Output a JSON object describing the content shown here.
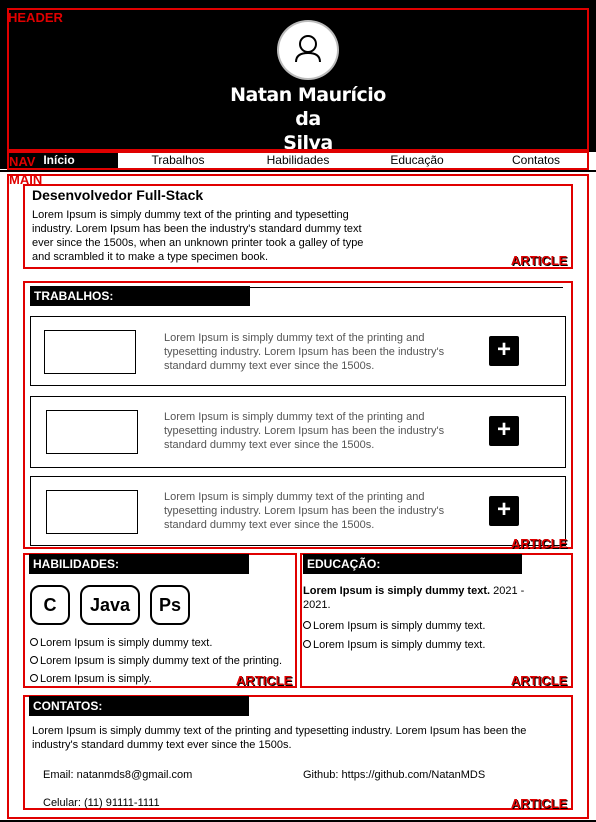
{
  "labels": {
    "header": "HEADER",
    "nav": "NAV",
    "main": "MAIN",
    "article": "ARTICLE"
  },
  "header": {
    "name_line1": "Natan Maurício da",
    "name_line2": "Silva",
    "avatar_icon": "user-icon"
  },
  "nav": {
    "items": [
      "Início",
      "Trabalhos",
      "Habilidades",
      "Educação",
      "Contatos"
    ],
    "active": "Início"
  },
  "intro": {
    "title": "Desenvolvedor Full-Stack",
    "text": "Lorem Ipsum is simply dummy text of the printing and typesetting industry. Lorem Ipsum has been the industry's standard dummy text ever since the 1500s, when an unknown printer took a galley of type and scrambled it to make a type specimen book."
  },
  "trabalhos": {
    "title": "TRABALHOS:",
    "cards": [
      {
        "text": "Lorem Ipsum is simply dummy text of the printing and typesetting industry. Lorem Ipsum has been the industry's standard dummy text ever since the 1500s.",
        "button": "+"
      },
      {
        "text": "Lorem Ipsum is simply dummy text of the printing and typesetting industry. Lorem Ipsum has been the industry's standard dummy text ever since the 1500s.",
        "button": "+"
      },
      {
        "text": "Lorem Ipsum is simply dummy text of the printing and typesetting industry. Lorem Ipsum has been the industry's standard dummy text ever since the 1500s.",
        "button": "+"
      }
    ]
  },
  "habilidades": {
    "title": "HABILIDADES:",
    "chips": [
      "C",
      "Java",
      "Ps"
    ],
    "items": [
      "Lorem Ipsum is simply dummy text.",
      "Lorem Ipsum is simply dummy text of the printing.",
      "Lorem Ipsum is simply."
    ]
  },
  "educacao": {
    "title": "EDUCAÇÃO:",
    "bold": "Lorem Ipsum is simply dummy text.",
    "years_a": "2021 -",
    "years_b": "2021.",
    "items": [
      "Lorem Ipsum is simply dummy text.",
      "Lorem Ipsum is simply dummy text."
    ]
  },
  "contatos": {
    "title": "CONTATOS:",
    "text": "Lorem Ipsum is simply dummy text of the printing and typesetting industry. Lorem Ipsum has been the industry's standard dummy text ever since the 1500s.",
    "email": "Email: natanmds8@gmail.com",
    "github": "Github: https://github.com/NatanMDS",
    "phone": "Celular: (11) 91111-1111"
  }
}
